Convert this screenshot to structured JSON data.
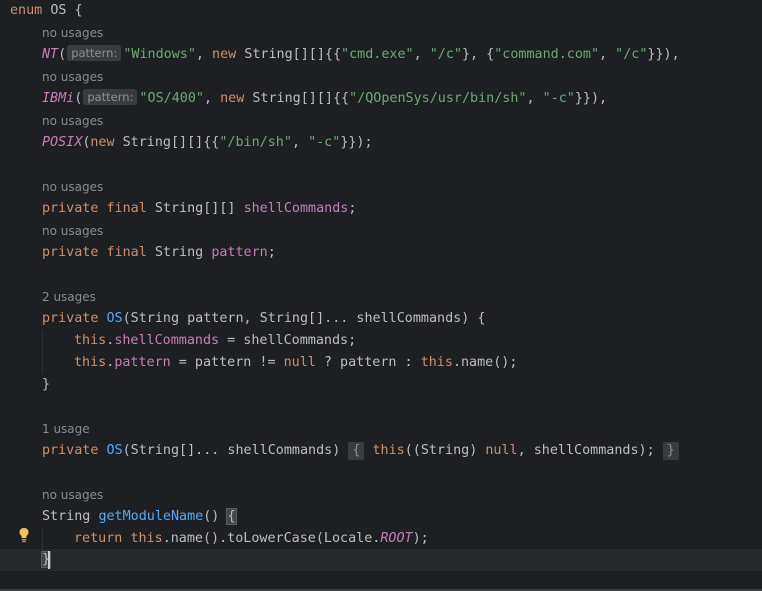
{
  "editor": {
    "hint_no_usages": "no usages",
    "hint_2_usages": "2 usages",
    "hint_1_usage": "1 usage",
    "param_hint_pattern": "pattern:",
    "kw_enum": "enum",
    "name_os": "OS",
    "open_brace": " {",
    "close_brace": "}",
    "nt": "NT",
    "ibmi": "IBMi",
    "posix": "POSIX",
    "str_windows": "\"Windows\"",
    "str_cmd": "\"cmd.exe\"",
    "str_c": "\"/c\"",
    "str_command": "\"command.com\"",
    "str_c2": "\"/c\"",
    "str_os400": "\"OS/400\"",
    "str_qopen": "\"/QOpenSys/usr/bin/sh\"",
    "str_dashc": "\"-c\"",
    "str_binsh": "\"/bin/sh\"",
    "str_dashc2": "\"-c\"",
    "kw_new": "new",
    "kw_private": "private",
    "kw_final": "final",
    "kw_this": "this",
    "kw_null": "null",
    "kw_return": "return",
    "field_shellCommands": "shellCommands",
    "field_pattern": "pattern",
    "method_getModuleName": "getModuleName",
    "ctor_os": "OS",
    "locale_root": "ROOT"
  },
  "colors": {
    "background": "#1e1f22",
    "keyword": "#cf8e6d",
    "string": "#6aab73",
    "enum_constant": "#c77dbb",
    "method": "#56a8f5",
    "hint": "#868a91"
  },
  "icons": {
    "gutter": "lightbulb-icon"
  }
}
